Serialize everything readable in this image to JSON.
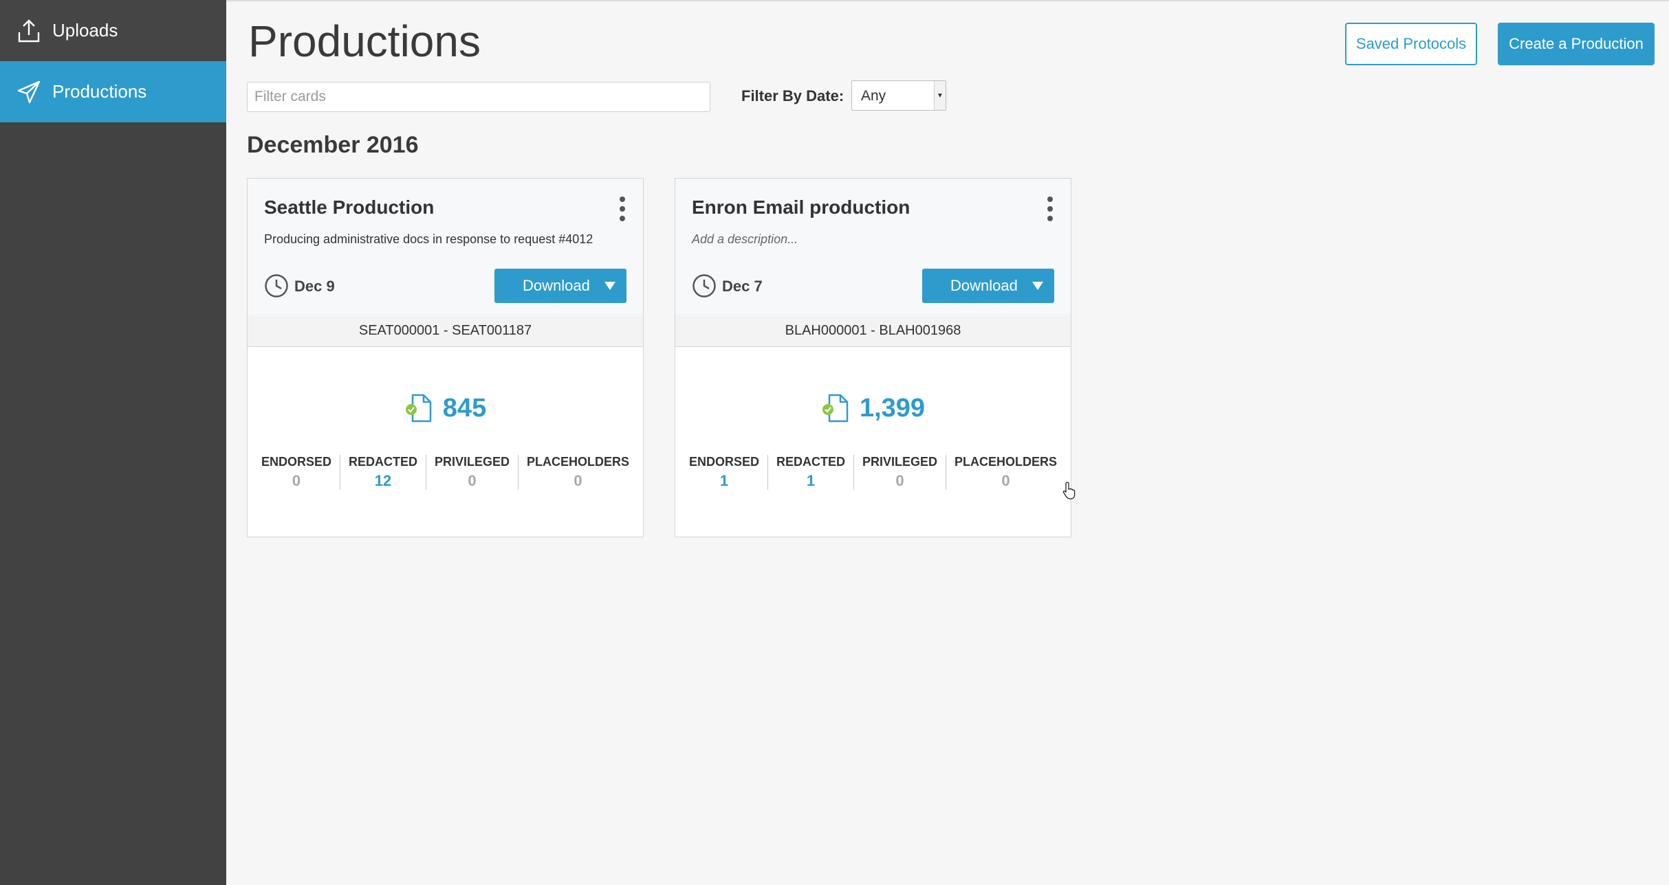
{
  "sidebar": {
    "items": [
      {
        "label": "Uploads",
        "icon": "upload-icon"
      },
      {
        "label": "Productions",
        "icon": "paper-plane-icon",
        "active": true
      }
    ]
  },
  "header": {
    "title": "Productions",
    "saved_protocols_label": "Saved Protocols",
    "create_label": "Create a Production"
  },
  "filters": {
    "placeholder": "Filter cards",
    "date_label": "Filter By Date:",
    "date_value": "Any"
  },
  "section": {
    "title": "December 2016"
  },
  "cards": [
    {
      "title": "Seattle Production",
      "description": "Producing administrative docs in response to request #4012",
      "date": "Dec 9",
      "download_label": "Download",
      "bates": "SEAT000001 - SEAT001187",
      "count": "845",
      "stats": [
        {
          "label": "ENDORSED",
          "value": "0"
        },
        {
          "label": "REDACTED",
          "value": "12"
        },
        {
          "label": "PRIVILEGED",
          "value": "0"
        },
        {
          "label": "PLACEHOLDERS",
          "value": "0"
        }
      ]
    },
    {
      "title": "Enron Email production",
      "description": "Add a description...",
      "date": "Dec 7",
      "download_label": "Download",
      "bates": "BLAH000001 - BLAH001968",
      "count": "1,399",
      "stats": [
        {
          "label": "ENDORSED",
          "value": "1"
        },
        {
          "label": "REDACTED",
          "value": "1"
        },
        {
          "label": "PRIVILEGED",
          "value": "0"
        },
        {
          "label": "PLACEHOLDERS",
          "value": "0"
        }
      ]
    }
  ],
  "colors": {
    "accent": "#2e9bcd",
    "sidebar": "#424242",
    "check": "#8dc63f"
  }
}
